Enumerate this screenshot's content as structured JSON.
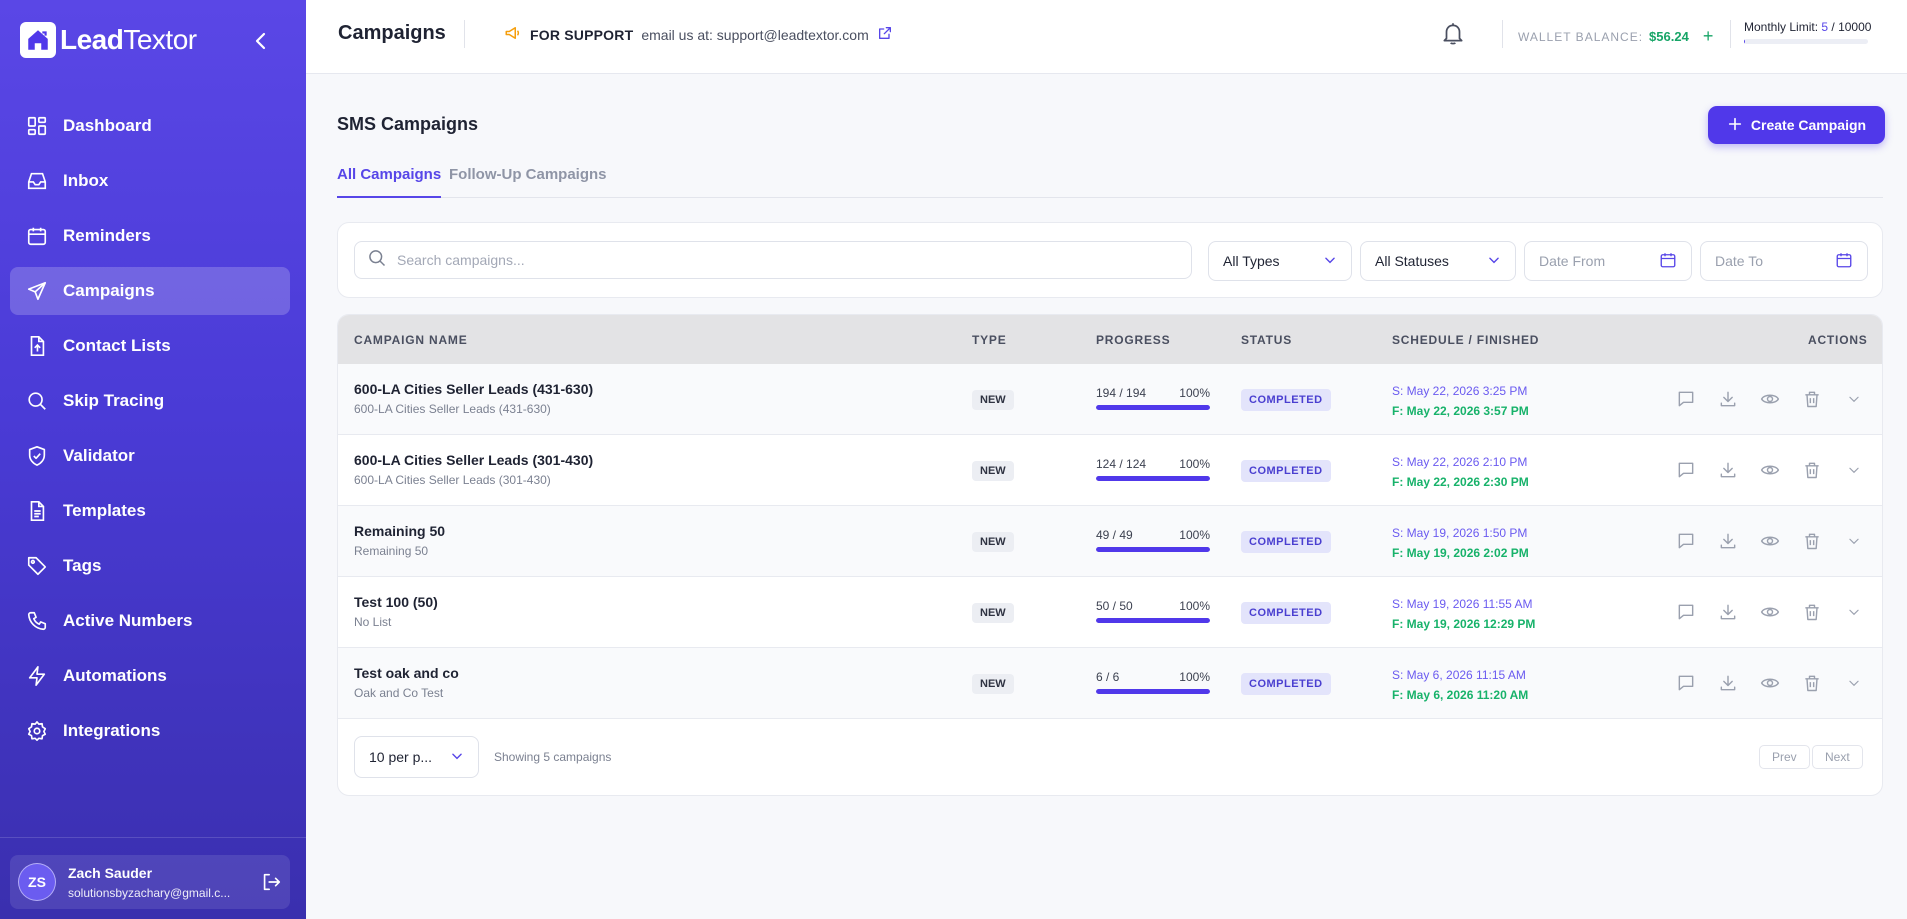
{
  "app": {
    "logo_bold": "Lead",
    "logo_thin": "Textor"
  },
  "sidebar": {
    "items": [
      {
        "label": "Dashboard",
        "icon": "dashboard-icon"
      },
      {
        "label": "Inbox",
        "icon": "inbox-icon"
      },
      {
        "label": "Reminders",
        "icon": "calendar-icon"
      },
      {
        "label": "Campaigns",
        "icon": "send-icon",
        "active": true
      },
      {
        "label": "Contact Lists",
        "icon": "file-upload-icon"
      },
      {
        "label": "Skip Tracing",
        "icon": "search-icon"
      },
      {
        "label": "Validator",
        "icon": "shield-check-icon"
      },
      {
        "label": "Templates",
        "icon": "document-icon"
      },
      {
        "label": "Tags",
        "icon": "tag-icon"
      },
      {
        "label": "Active Numbers",
        "icon": "phone-icon"
      },
      {
        "label": "Automations",
        "icon": "lightning-icon"
      },
      {
        "label": "Integrations",
        "icon": "gear-icon"
      }
    ],
    "user": {
      "initials": "ZS",
      "name": "Zach Sauder",
      "email": "solutionsbyzachary@gmail.c..."
    }
  },
  "topbar": {
    "title": "Campaigns",
    "support_label": "FOR SUPPORT",
    "support_text": "email us at: support@leadtextor.com",
    "wallet_label": "WALLET BALANCE:",
    "wallet_value": "$56.24",
    "wallet_add": "+",
    "limit_label": "Monthly Limit:",
    "limit_used": "5",
    "limit_sep": " / ",
    "limit_total": "10000",
    "limit_fraction": 0.0005
  },
  "main": {
    "section_title": "SMS Campaigns",
    "create_label": "Create Campaign",
    "tabs": [
      "All Campaigns",
      "Follow-Up Campaigns"
    ],
    "search_placeholder": "Search campaigns...",
    "filter_types": "All Types",
    "filter_statuses": "All Statuses",
    "date_from": "Date From",
    "date_to": "Date To"
  },
  "table": {
    "columns": [
      "CAMPAIGN NAME",
      "TYPE",
      "PROGRESS",
      "STATUS",
      "SCHEDULE / FINISHED",
      "ACTIONS"
    ],
    "rows": [
      {
        "name": "600-LA Cities Seller Leads (431-630)",
        "list": "600-LA Cities Seller Leads (431-630)",
        "type": "NEW",
        "progress": "194 / 194",
        "percent": "100%",
        "fraction": 1.0,
        "status": "COMPLETED",
        "start": "S: May 22, 2026 3:25 PM",
        "finish": "F: May 22, 2026 3:57 PM"
      },
      {
        "name": "600-LA Cities Seller Leads (301-430)",
        "list": "600-LA Cities Seller Leads (301-430)",
        "type": "NEW",
        "progress": "124 / 124",
        "percent": "100%",
        "fraction": 1.0,
        "status": "COMPLETED",
        "start": "S: May 22, 2026 2:10 PM",
        "finish": "F: May 22, 2026 2:30 PM"
      },
      {
        "name": "Remaining 50",
        "list": "Remaining 50",
        "type": "NEW",
        "progress": "49 / 49",
        "percent": "100%",
        "fraction": 1.0,
        "status": "COMPLETED",
        "start": "S: May 19, 2026 1:50 PM",
        "finish": "F: May 19, 2026 2:02 PM"
      },
      {
        "name": "Test 100 (50)",
        "list": "No List",
        "type": "NEW",
        "progress": "50 / 50",
        "percent": "100%",
        "fraction": 1.0,
        "status": "COMPLETED",
        "start": "S: May 19, 2026 11:55 AM",
        "finish": "F: May 19, 2026 12:29 PM"
      },
      {
        "name": "Test oak and co",
        "list": "Oak and Co Test",
        "type": "NEW",
        "progress": "6 / 6",
        "percent": "100%",
        "fraction": 1.0,
        "status": "COMPLETED",
        "start": "S: May 6, 2026 11:15 AM",
        "finish": "F: May 6, 2026 11:20 AM"
      }
    ],
    "per_page": "10 per p...",
    "showing": "Showing 5 campaigns",
    "prev": "Prev",
    "next": "Next"
  },
  "colors": {
    "accent": "#5038ea",
    "success": "#17b26a",
    "sidebar_top": "#5a47e6",
    "sidebar_bottom": "#3a2fae"
  }
}
